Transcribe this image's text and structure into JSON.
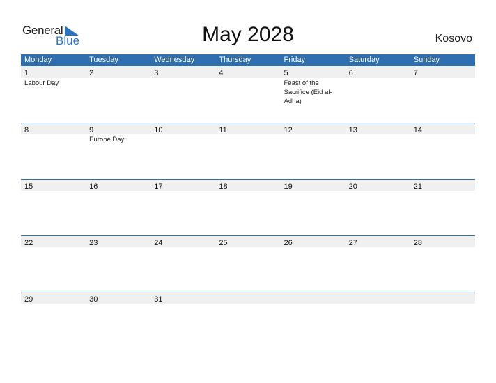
{
  "brand": {
    "general": "General",
    "blue": "Blue",
    "accent": "#2f6fb0"
  },
  "title": "May 2028",
  "country": "Kosovo",
  "weekdays": [
    "Monday",
    "Tuesday",
    "Wednesday",
    "Thursday",
    "Friday",
    "Saturday",
    "Sunday"
  ],
  "weeks": [
    {
      "days": [
        "1",
        "2",
        "3",
        "4",
        "5",
        "6",
        "7"
      ],
      "holidays": [
        "Labour Day",
        "",
        "",
        "",
        "Feast of the Sacrifice (Eid al-Adha)",
        "",
        ""
      ]
    },
    {
      "days": [
        "8",
        "9",
        "10",
        "11",
        "12",
        "13",
        "14"
      ],
      "holidays": [
        "",
        "Europe Day",
        "",
        "",
        "",
        "",
        ""
      ]
    },
    {
      "days": [
        "15",
        "16",
        "17",
        "18",
        "19",
        "20",
        "21"
      ],
      "holidays": [
        "",
        "",
        "",
        "",
        "",
        "",
        ""
      ]
    },
    {
      "days": [
        "22",
        "23",
        "24",
        "25",
        "26",
        "27",
        "28"
      ],
      "holidays": [
        "",
        "",
        "",
        "",
        "",
        "",
        ""
      ]
    },
    {
      "days": [
        "29",
        "30",
        "31",
        "",
        "",
        "",
        ""
      ],
      "holidays": [
        "",
        "",
        "",
        "",
        "",
        "",
        ""
      ]
    }
  ]
}
